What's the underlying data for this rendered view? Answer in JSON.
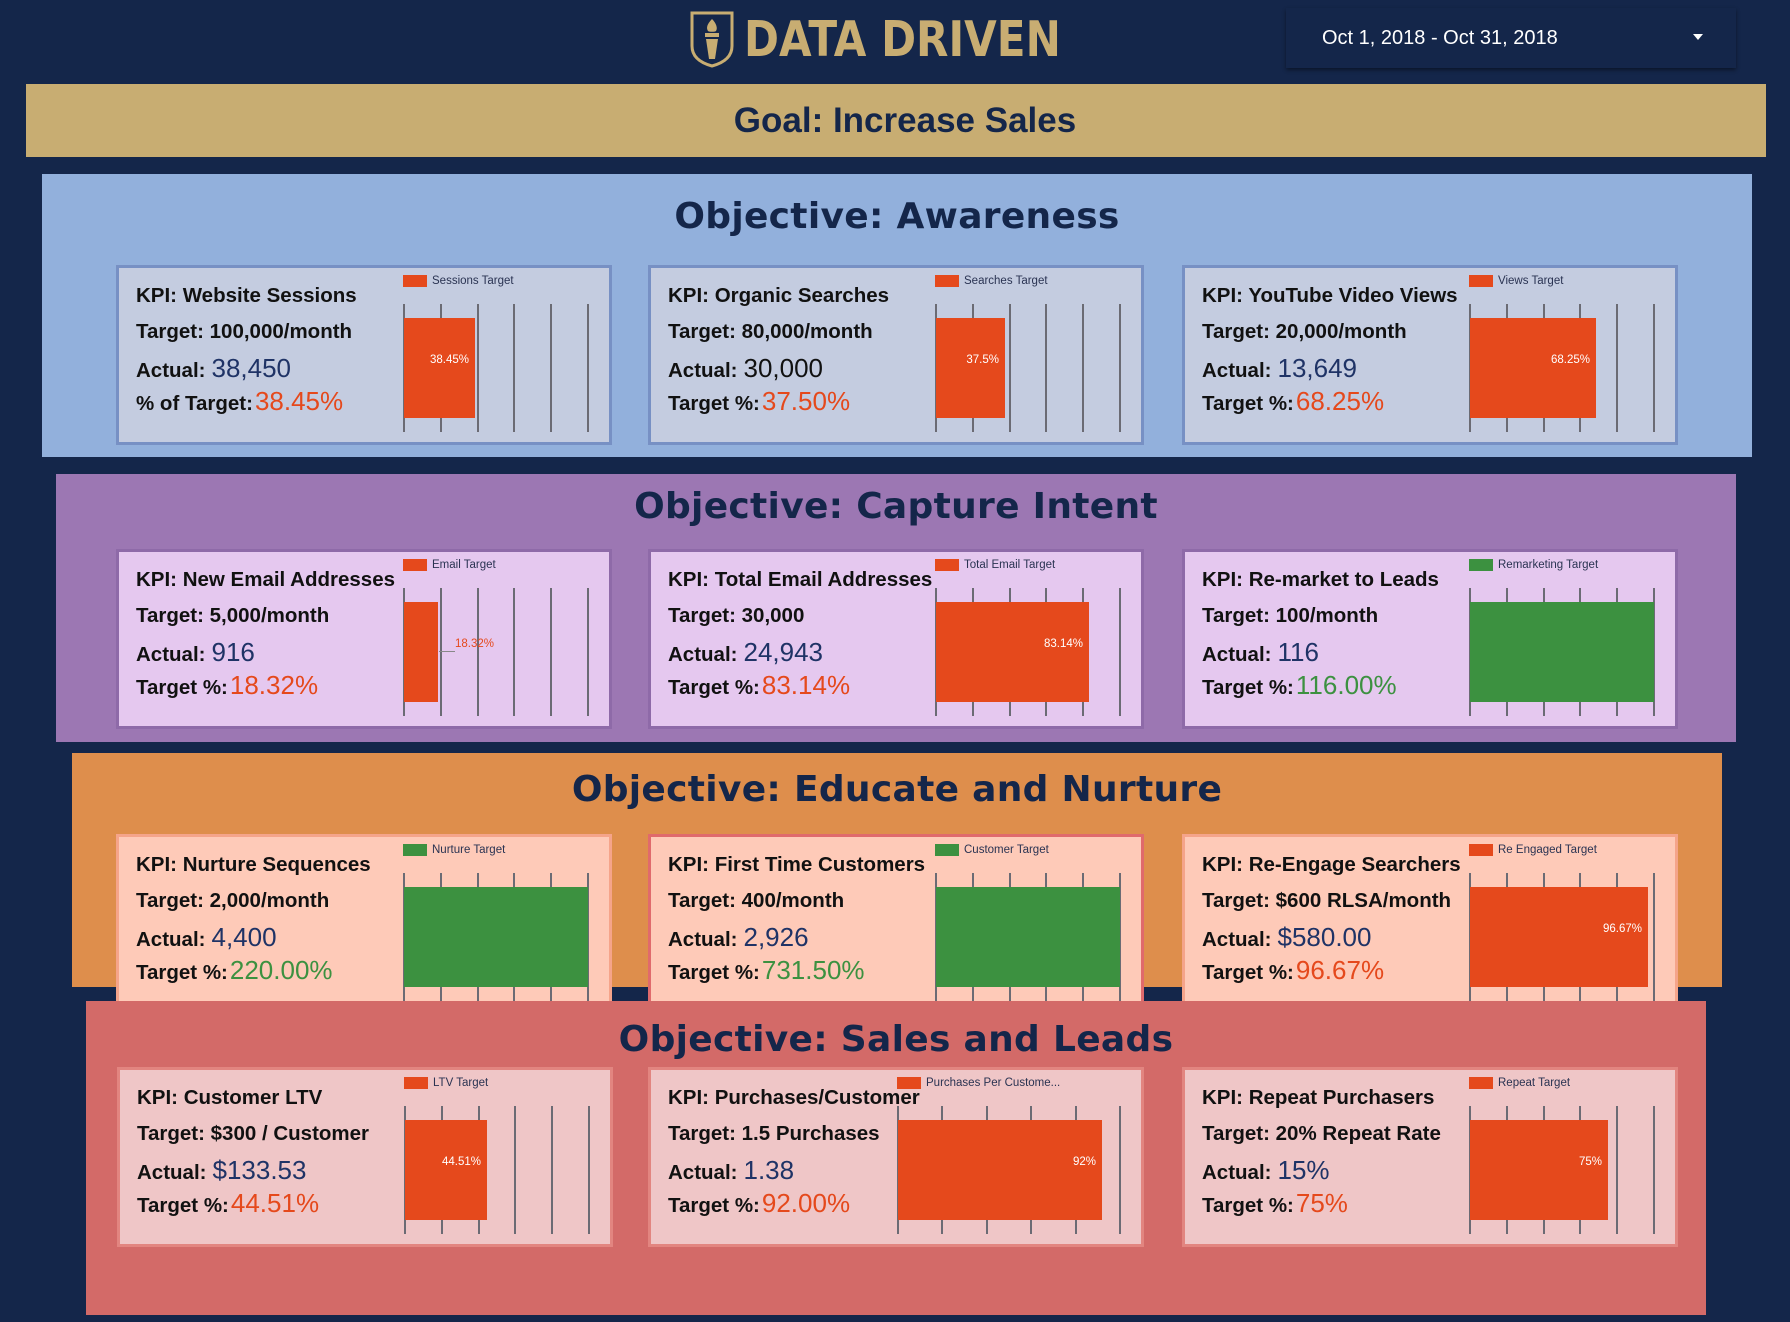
{
  "header": {
    "logo_text": "DATA DRIVEN",
    "logo_icon": "torch-shield-icon",
    "date_range": "Oct 1, 2018 - Oct 31, 2018",
    "date_range_icon": "caret-down-icon"
  },
  "goal": {
    "title": "Goal: Increase Sales"
  },
  "colors": {
    "page_bg": "#14264a",
    "gold": "#c8ad72",
    "bar_under_target": "#e5491c",
    "bar_over_target": "#3c9140",
    "actual_value": "#1f3366"
  },
  "sections": [
    {
      "title": "Objective: Awareness",
      "cards": [
        {
          "kpi": "KPI: Website Sessions",
          "target": "Target: 100,000/month",
          "actual_label": "Actual:",
          "actual": "38,450",
          "pct_label": "% of Target:",
          "pct": "38.45%",
          "status": "under",
          "legend": "Sessions Target",
          "bar_label": "38.45%"
        },
        {
          "kpi": "KPI: Organic Searches",
          "target": "Target: 80,000/month",
          "actual_label": "Actual:",
          "actual": "30,000",
          "pct_label": "Target %:",
          "pct": "37.50%",
          "status": "under",
          "legend": "Searches Target",
          "bar_label": "37.5%"
        },
        {
          "kpi": "KPI: YouTube Video Views",
          "target": "Target: 20,000/month",
          "actual_label": "Actual:",
          "actual": "13,649",
          "pct_label": "Target %:",
          "pct": "68.25%",
          "status": "under",
          "legend": "Views Target",
          "bar_label": "68.25%"
        }
      ]
    },
    {
      "title": "Objective: Capture Intent",
      "cards": [
        {
          "kpi": "KPI: New Email Addresses",
          "target": "Target: 5,000/month",
          "actual_label": "Actual:",
          "actual": "916",
          "pct_label": "Target %:",
          "pct": "18.32%",
          "status": "under",
          "legend": "Email Target",
          "bar_label": "18.32%"
        },
        {
          "kpi": "KPI: Total Email Addresses",
          "target": "Target: 30,000",
          "actual_label": "Actual:",
          "actual": "24,943",
          "pct_label": "Target %:",
          "pct": "83.14%",
          "status": "under",
          "legend": "Total Email Target",
          "bar_label": "83.14%"
        },
        {
          "kpi": "KPI: Re-market to Leads",
          "target": "Target: 100/month",
          "actual_label": "Actual:",
          "actual": "116",
          "pct_label": "Target %:",
          "pct": "116.00%",
          "status": "over",
          "legend": "Remarketing Target",
          "bar_label": ""
        }
      ]
    },
    {
      "title": "Objective: Educate and Nurture",
      "cards": [
        {
          "kpi": "KPI: Nurture Sequences",
          "target": "Target: 2,000/month",
          "actual_label": "Actual:",
          "actual": "4,400",
          "pct_label": "Target %:",
          "pct": "220.00%",
          "status": "over",
          "legend": "Nurture Target",
          "bar_label": ""
        },
        {
          "kpi": "KPI: First Time Customers",
          "target": "Target: 400/month",
          "actual_label": "Actual:",
          "actual": "2,926",
          "pct_label": "Target %:",
          "pct": "731.50%",
          "status": "over",
          "legend": "Customer Target",
          "bar_label": ""
        },
        {
          "kpi": "KPI: Re-Engage Searchers",
          "target": "Target: $600 RLSA/month",
          "actual_label": "Actual:",
          "actual": "$580.00",
          "pct_label": "Target %:",
          "pct": "96.67%",
          "status": "under",
          "legend": "Re Engaged Target",
          "bar_label": "96.67%"
        }
      ]
    },
    {
      "title": "Objective: Sales and Leads",
      "cards": [
        {
          "kpi": "KPI: Customer LTV",
          "target": "Target: $300 / Customer",
          "actual_label": "Actual:",
          "actual": "$133.53",
          "pct_label": "Target %:",
          "pct": "44.51%",
          "status": "under",
          "legend": "LTV Target",
          "bar_label": "44.51%"
        },
        {
          "kpi": "KPI: Purchases/Customer",
          "target": "Target: 1.5 Purchases",
          "actual_label": "Actual:",
          "actual": "1.38",
          "pct_label": "Target %:",
          "pct": "92.00%",
          "status": "under",
          "legend": "Purchases Per Custome...",
          "bar_label": "92%"
        },
        {
          "kpi": "KPI: Repeat Purchasers",
          "target": "Target: 20% Repeat Rate",
          "actual_label": "Actual:",
          "actual": "15%",
          "pct_label": "Target %:",
          "pct": "75%",
          "status": "under",
          "legend": "Repeat Target",
          "bar_label": "75%"
        }
      ]
    }
  ],
  "chart_data": [
    {
      "type": "bar",
      "title": "Sessions Target",
      "legend": [
        "Sessions Target"
      ],
      "values": [
        38.45
      ],
      "xlim": [
        0,
        100
      ],
      "ticks": [
        0,
        20,
        40,
        60,
        80,
        100
      ],
      "data_label": "38.45%"
    },
    {
      "type": "bar",
      "title": "Searches Target",
      "legend": [
        "Searches Target"
      ],
      "values": [
        37.5
      ],
      "xlim": [
        0,
        100
      ],
      "ticks": [
        0,
        20,
        40,
        60,
        80,
        100
      ],
      "data_label": "37.5%"
    },
    {
      "type": "bar",
      "title": "Views Target",
      "legend": [
        "Views Target"
      ],
      "values": [
        68.25
      ],
      "xlim": [
        0,
        100
      ],
      "ticks": [
        0,
        20,
        40,
        60,
        80,
        100
      ],
      "data_label": "68.25%"
    },
    {
      "type": "bar",
      "title": "Email Target",
      "legend": [
        "Email Target"
      ],
      "values": [
        18.32
      ],
      "xlim": [
        0,
        100
      ],
      "ticks": [
        0,
        20,
        40,
        60,
        80,
        100
      ],
      "data_label": "18.32%"
    },
    {
      "type": "bar",
      "title": "Total Email Target",
      "legend": [
        "Total Email Target"
      ],
      "values": [
        83.14
      ],
      "xlim": [
        0,
        100
      ],
      "ticks": [
        0,
        20,
        40,
        60,
        80,
        100
      ],
      "data_label": "83.14%"
    },
    {
      "type": "bar",
      "title": "Remarketing Target",
      "legend": [
        "Remarketing Target"
      ],
      "values": [
        116
      ],
      "xlim": [
        0,
        100
      ],
      "ticks": [
        0,
        20,
        40,
        60,
        80,
        100
      ],
      "data_label": ""
    },
    {
      "type": "bar",
      "title": "Nurture Target",
      "legend": [
        "Nurture Target"
      ],
      "values": [
        220
      ],
      "xlim": [
        0,
        100
      ],
      "ticks": [
        0,
        20,
        40,
        60,
        80,
        100
      ],
      "data_label": ""
    },
    {
      "type": "bar",
      "title": "Customer Target",
      "legend": [
        "Customer Target"
      ],
      "values": [
        731.5
      ],
      "xlim": [
        0,
        100
      ],
      "ticks": [
        0,
        20,
        40,
        60,
        80,
        100
      ],
      "data_label": ""
    },
    {
      "type": "bar",
      "title": "Re Engaged Target",
      "legend": [
        "Re Engaged Target"
      ],
      "values": [
        96.67
      ],
      "xlim": [
        0,
        100
      ],
      "ticks": [
        0,
        20,
        40,
        60,
        80,
        100
      ],
      "data_label": "96.67%"
    },
    {
      "type": "bar",
      "title": "LTV Target",
      "legend": [
        "LTV Target"
      ],
      "values": [
        44.51
      ],
      "xlim": [
        0,
        100
      ],
      "ticks": [
        0,
        20,
        40,
        60,
        80,
        100
      ],
      "data_label": "44.51%"
    },
    {
      "type": "bar",
      "title": "Purchases Per Customer Target",
      "legend": [
        "Purchases Per Custome..."
      ],
      "values": [
        92
      ],
      "xlim": [
        0,
        100
      ],
      "ticks": [
        0,
        20,
        40,
        60,
        80,
        100
      ],
      "data_label": "92%"
    },
    {
      "type": "bar",
      "title": "Repeat Target",
      "legend": [
        "Repeat Target"
      ],
      "values": [
        75
      ],
      "xlim": [
        0,
        100
      ],
      "ticks": [
        0,
        20,
        40,
        60,
        80,
        100
      ],
      "data_label": "75%"
    }
  ]
}
